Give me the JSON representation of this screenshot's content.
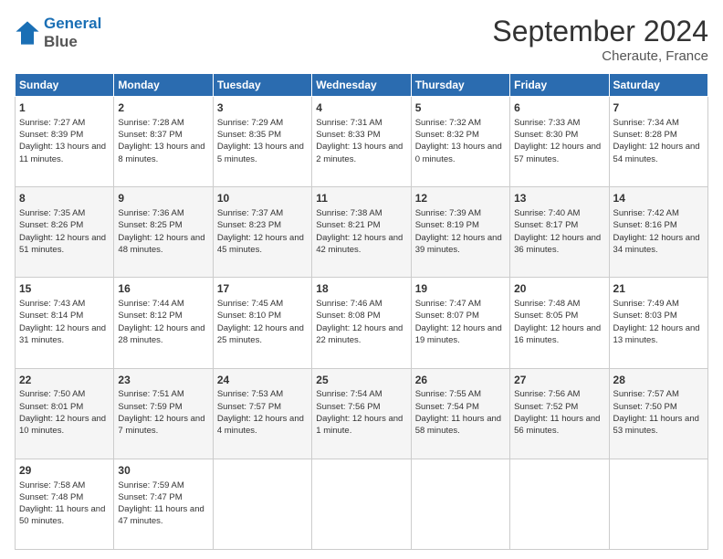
{
  "header": {
    "logo_line1": "General",
    "logo_line2": "Blue",
    "month_title": "September 2024",
    "location": "Cheraute, France"
  },
  "weekdays": [
    "Sunday",
    "Monday",
    "Tuesday",
    "Wednesday",
    "Thursday",
    "Friday",
    "Saturday"
  ],
  "weeks": [
    [
      {
        "day": "1",
        "sunrise": "7:27 AM",
        "sunset": "8:39 PM",
        "daylight": "13 hours and 11 minutes."
      },
      {
        "day": "2",
        "sunrise": "7:28 AM",
        "sunset": "8:37 PM",
        "daylight": "13 hours and 8 minutes."
      },
      {
        "day": "3",
        "sunrise": "7:29 AM",
        "sunset": "8:35 PM",
        "daylight": "13 hours and 5 minutes."
      },
      {
        "day": "4",
        "sunrise": "7:31 AM",
        "sunset": "8:33 PM",
        "daylight": "13 hours and 2 minutes."
      },
      {
        "day": "5",
        "sunrise": "7:32 AM",
        "sunset": "8:32 PM",
        "daylight": "13 hours and 0 minutes."
      },
      {
        "day": "6",
        "sunrise": "7:33 AM",
        "sunset": "8:30 PM",
        "daylight": "12 hours and 57 minutes."
      },
      {
        "day": "7",
        "sunrise": "7:34 AM",
        "sunset": "8:28 PM",
        "daylight": "12 hours and 54 minutes."
      }
    ],
    [
      {
        "day": "8",
        "sunrise": "7:35 AM",
        "sunset": "8:26 PM",
        "daylight": "12 hours and 51 minutes."
      },
      {
        "day": "9",
        "sunrise": "7:36 AM",
        "sunset": "8:25 PM",
        "daylight": "12 hours and 48 minutes."
      },
      {
        "day": "10",
        "sunrise": "7:37 AM",
        "sunset": "8:23 PM",
        "daylight": "12 hours and 45 minutes."
      },
      {
        "day": "11",
        "sunrise": "7:38 AM",
        "sunset": "8:21 PM",
        "daylight": "12 hours and 42 minutes."
      },
      {
        "day": "12",
        "sunrise": "7:39 AM",
        "sunset": "8:19 PM",
        "daylight": "12 hours and 39 minutes."
      },
      {
        "day": "13",
        "sunrise": "7:40 AM",
        "sunset": "8:17 PM",
        "daylight": "12 hours and 36 minutes."
      },
      {
        "day": "14",
        "sunrise": "7:42 AM",
        "sunset": "8:16 PM",
        "daylight": "12 hours and 34 minutes."
      }
    ],
    [
      {
        "day": "15",
        "sunrise": "7:43 AM",
        "sunset": "8:14 PM",
        "daylight": "12 hours and 31 minutes."
      },
      {
        "day": "16",
        "sunrise": "7:44 AM",
        "sunset": "8:12 PM",
        "daylight": "12 hours and 28 minutes."
      },
      {
        "day": "17",
        "sunrise": "7:45 AM",
        "sunset": "8:10 PM",
        "daylight": "12 hours and 25 minutes."
      },
      {
        "day": "18",
        "sunrise": "7:46 AM",
        "sunset": "8:08 PM",
        "daylight": "12 hours and 22 minutes."
      },
      {
        "day": "19",
        "sunrise": "7:47 AM",
        "sunset": "8:07 PM",
        "daylight": "12 hours and 19 minutes."
      },
      {
        "day": "20",
        "sunrise": "7:48 AM",
        "sunset": "8:05 PM",
        "daylight": "12 hours and 16 minutes."
      },
      {
        "day": "21",
        "sunrise": "7:49 AM",
        "sunset": "8:03 PM",
        "daylight": "12 hours and 13 minutes."
      }
    ],
    [
      {
        "day": "22",
        "sunrise": "7:50 AM",
        "sunset": "8:01 PM",
        "daylight": "12 hours and 10 minutes."
      },
      {
        "day": "23",
        "sunrise": "7:51 AM",
        "sunset": "7:59 PM",
        "daylight": "12 hours and 7 minutes."
      },
      {
        "day": "24",
        "sunrise": "7:53 AM",
        "sunset": "7:57 PM",
        "daylight": "12 hours and 4 minutes."
      },
      {
        "day": "25",
        "sunrise": "7:54 AM",
        "sunset": "7:56 PM",
        "daylight": "12 hours and 1 minute."
      },
      {
        "day": "26",
        "sunrise": "7:55 AM",
        "sunset": "7:54 PM",
        "daylight": "11 hours and 58 minutes."
      },
      {
        "day": "27",
        "sunrise": "7:56 AM",
        "sunset": "7:52 PM",
        "daylight": "11 hours and 56 minutes."
      },
      {
        "day": "28",
        "sunrise": "7:57 AM",
        "sunset": "7:50 PM",
        "daylight": "11 hours and 53 minutes."
      }
    ],
    [
      {
        "day": "29",
        "sunrise": "7:58 AM",
        "sunset": "7:48 PM",
        "daylight": "11 hours and 50 minutes."
      },
      {
        "day": "30",
        "sunrise": "7:59 AM",
        "sunset": "7:47 PM",
        "daylight": "11 hours and 47 minutes."
      },
      null,
      null,
      null,
      null,
      null
    ]
  ]
}
